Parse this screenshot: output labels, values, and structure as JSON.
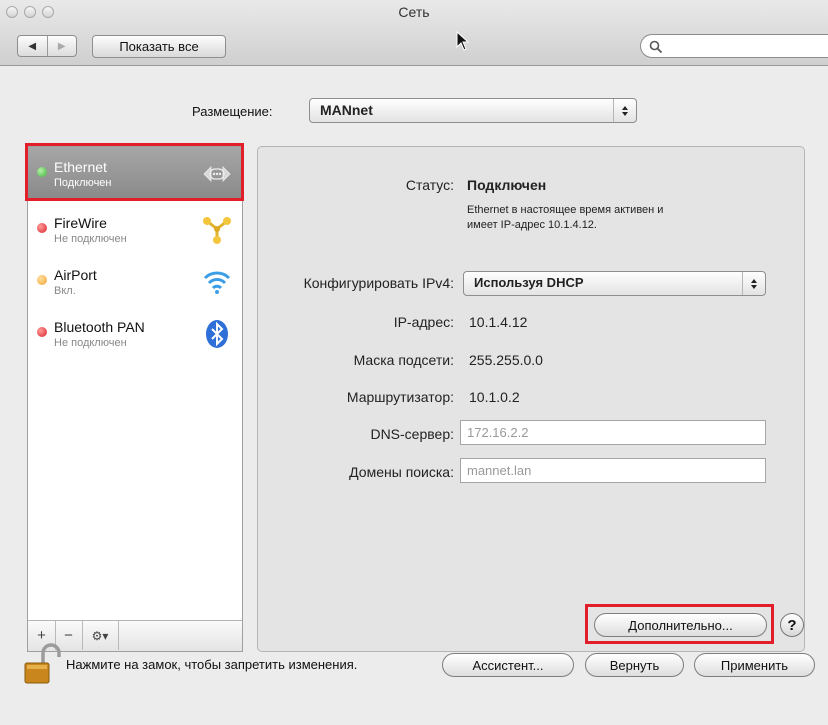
{
  "window": {
    "title": "Сеть"
  },
  "toolbar": {
    "back": "◀",
    "forward": "▶",
    "show_all": "Показать все",
    "search_placeholder": ""
  },
  "location": {
    "label": "Размещение:",
    "value": "MANnet"
  },
  "services": [
    {
      "name": "Ethernet",
      "status": "Подключен",
      "dot_color": "#3fb43a",
      "icon": "ethernet-icon",
      "selected": true
    },
    {
      "name": "FireWire",
      "status": "Не подключен",
      "dot_color": "#d9232b",
      "icon": "firewire-icon",
      "selected": false
    },
    {
      "name": "AirPort",
      "status": "Вкл.",
      "dot_color": "#f0a12c",
      "icon": "wifi-icon",
      "selected": false
    },
    {
      "name": "Bluetooth PAN",
      "status": "Не подключен",
      "dot_color": "#d9232b",
      "icon": "bluetooth-icon",
      "selected": false
    }
  ],
  "sidebar_bar": {
    "add": "+",
    "remove": "−",
    "gear": "⚙▾"
  },
  "detail": {
    "status_label": "Статус:",
    "status_value": "Подключен",
    "status_note_1": "Ethernet в настоящее время активен и",
    "status_note_2": "имеет IP-адрес 10.1.4.12.",
    "configure_label": "Конфигурировать IPv4:",
    "configure_value": "Используя DHCP",
    "ip_label": "IP-адрес:",
    "ip_value": "10.1.4.12",
    "mask_label": "Маска подсети:",
    "mask_value": "255.255.0.0",
    "router_label": "Маршрутизатор:",
    "router_value": "10.1.0.2",
    "dns_label": "DNS-сервер:",
    "dns_value": "172.16.2.2",
    "domains_label": "Домены поиска:",
    "domains_value": "mannet.lan",
    "advanced": "Дополнительно...",
    "help": "?"
  },
  "footer": {
    "lock_text": "Нажмите на замок, чтобы запретить изменения.",
    "assistant": "Ассистент...",
    "revert": "Вернуть",
    "apply": "Применить"
  },
  "colors": {
    "highlight": "#e21e2a",
    "selection": "#999999"
  }
}
